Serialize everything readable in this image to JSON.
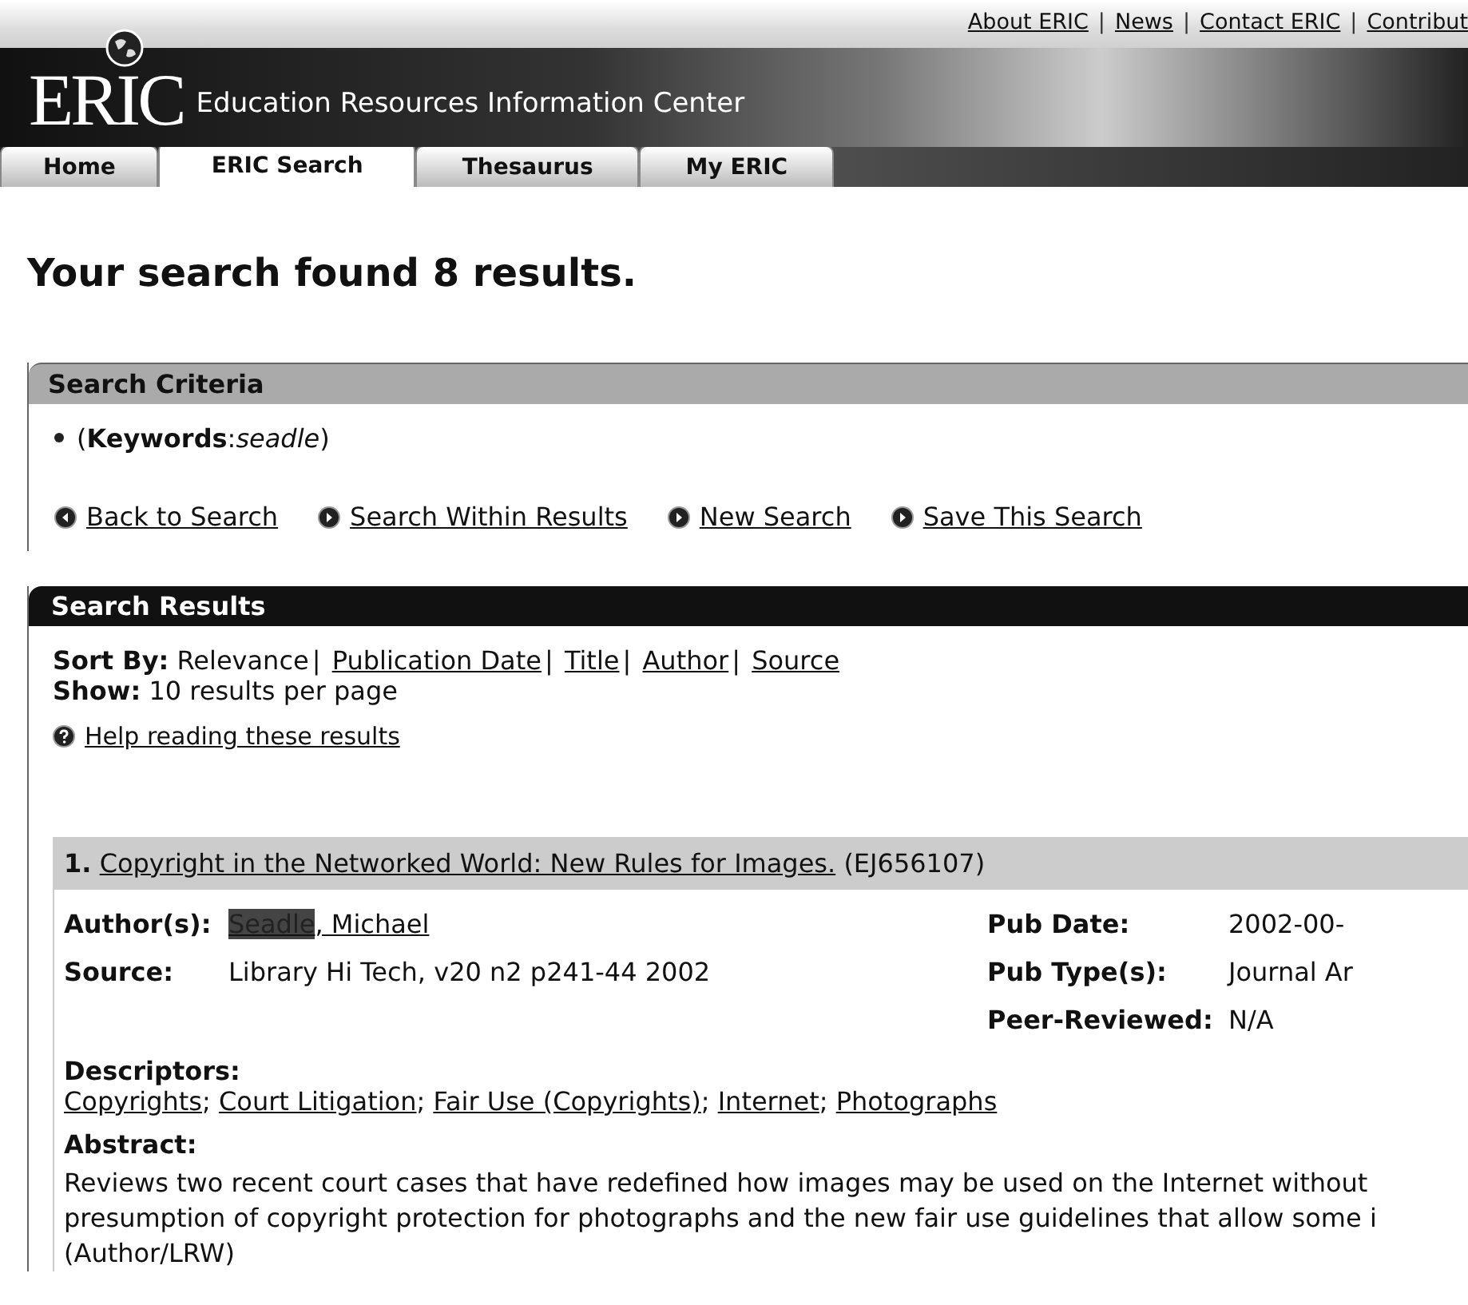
{
  "top_links": [
    "About ERIC",
    "News",
    "Contact ERIC",
    "Contribut"
  ],
  "top_link_separator": "|",
  "banner": {
    "logo": "ERIC",
    "subtitle": "Education Resources Information Center"
  },
  "tabs": [
    {
      "label": "Home",
      "selected": false
    },
    {
      "label": "ERIC Search",
      "selected": true
    },
    {
      "label": "Thesaurus",
      "selected": false
    },
    {
      "label": "My ERIC",
      "selected": false
    }
  ],
  "heading": "Your search found 8 results.",
  "criteria": {
    "title": "Search Criteria",
    "items": [
      "(**Keywords**:*seadle*)"
    ],
    "actions": [
      {
        "label": "Back to Search",
        "kind": "back"
      },
      {
        "label": "Search Within Results",
        "kind": "forward"
      },
      {
        "label": "New Search",
        "kind": "forward"
      },
      {
        "label": "Save This Search",
        "kind": "forward"
      }
    ]
  },
  "results": {
    "title": "Search Results",
    "sort_label": "Sort By:",
    "sort_options": [
      {
        "label": "Relevance",
        "selected": true
      },
      {
        "label": "Publication Date",
        "selected": false
      },
      {
        "label": "Title",
        "selected": false
      },
      {
        "label": "Author",
        "selected": false
      },
      {
        "label": "Source",
        "selected": false
      }
    ],
    "sort_separator": "|",
    "show_label": "Show:",
    "show_value": "10 results per page",
    "help": "Help reading these results",
    "items": [
      {
        "number": "1.",
        "title": "Copyright in the Networked World: New Rules for Images.",
        "id": "(EJ656107)",
        "author_label": "Author(s):",
        "author_match": "Seadle",
        "author_rest": ", Michael",
        "source_label": "Source:",
        "source": "Library Hi Tech, v20 n2 p241-44 2002",
        "meta": [
          {
            "label": "Pub Date:",
            "value": "2002-00-"
          },
          {
            "label": "Pub Type(s):",
            "value": "Journal Ar"
          },
          {
            "label": "Peer-Reviewed:",
            "value": "N/A"
          }
        ],
        "descriptors_label": "Descriptors:",
        "descriptor_separator": ";",
        "descriptors": [
          "Copyrights",
          "Court Litigation",
          "Fair Use (Copyrights)",
          "Internet",
          "Photographs"
        ],
        "abstract_label": "Abstract:",
        "abstract": [
          "Reviews two recent court cases that have redefined how images may be used on the Internet without",
          "presumption of copyright protection for photographs and the new fair use guidelines that allow some i",
          "(Author/LRW)"
        ]
      }
    ]
  }
}
